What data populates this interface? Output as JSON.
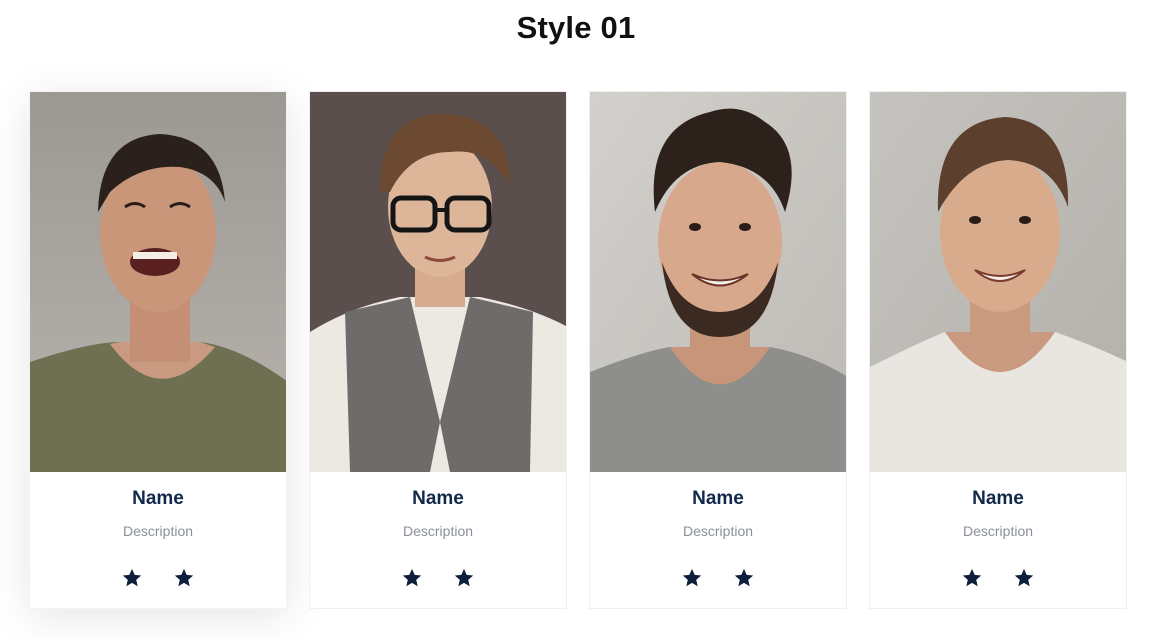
{
  "section": {
    "title": "Style 01"
  },
  "cards": [
    {
      "name": "Name",
      "description": "Description",
      "rating_icons": [
        "star-icon",
        "star-icon"
      ]
    },
    {
      "name": "Name",
      "description": "Description",
      "rating_icons": [
        "star-icon",
        "star-icon"
      ]
    },
    {
      "name": "Name",
      "description": "Description",
      "rating_icons": [
        "star-icon",
        "star-icon"
      ]
    },
    {
      "name": "Name",
      "description": "Description",
      "rating_icons": [
        "star-icon",
        "star-icon"
      ]
    }
  ],
  "colors": {
    "name_text": "#13294b",
    "description_text": "#8a8f99",
    "star": "#0d1f3c",
    "title_text": "#111111"
  }
}
